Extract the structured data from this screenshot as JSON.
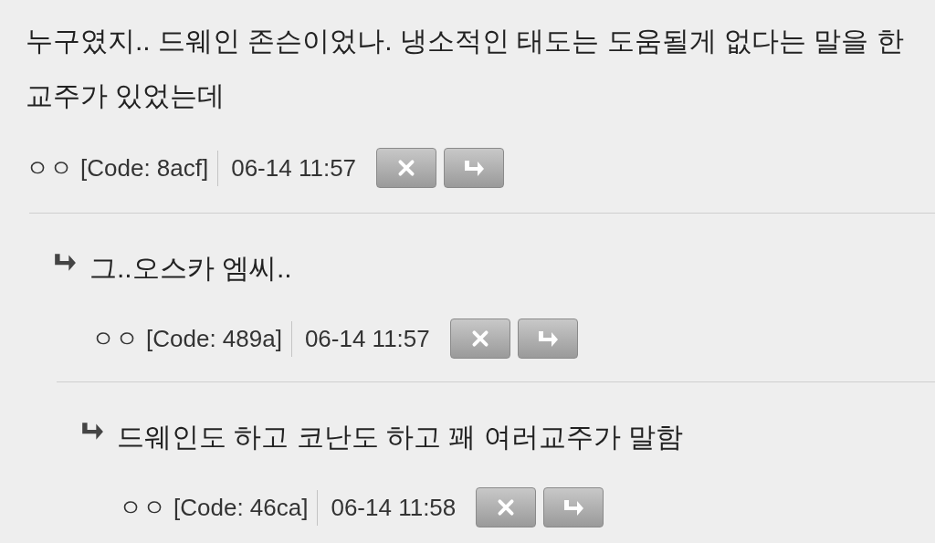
{
  "comments": [
    {
      "text": "누구였지.. 드웨인 존슨이었나. 냉소적인 태도는 도움될게 없다는 말을 한 교주가 있었는데",
      "author": "ㅇㅇ",
      "code": "[Code: 8acf]",
      "time": "06-14 11:57",
      "children": [
        {
          "text": "그..오스카 엠씨..",
          "author": "ㅇㅇ",
          "code": "[Code: 489a]",
          "time": "06-14 11:57",
          "children": [
            {
              "text": "드웨인도 하고 코난도 하고 꽤 여러교주가 말함",
              "author": "ㅇㅇ",
              "code": "[Code: 46ca]",
              "time": "06-14 11:58"
            }
          ]
        }
      ]
    }
  ]
}
